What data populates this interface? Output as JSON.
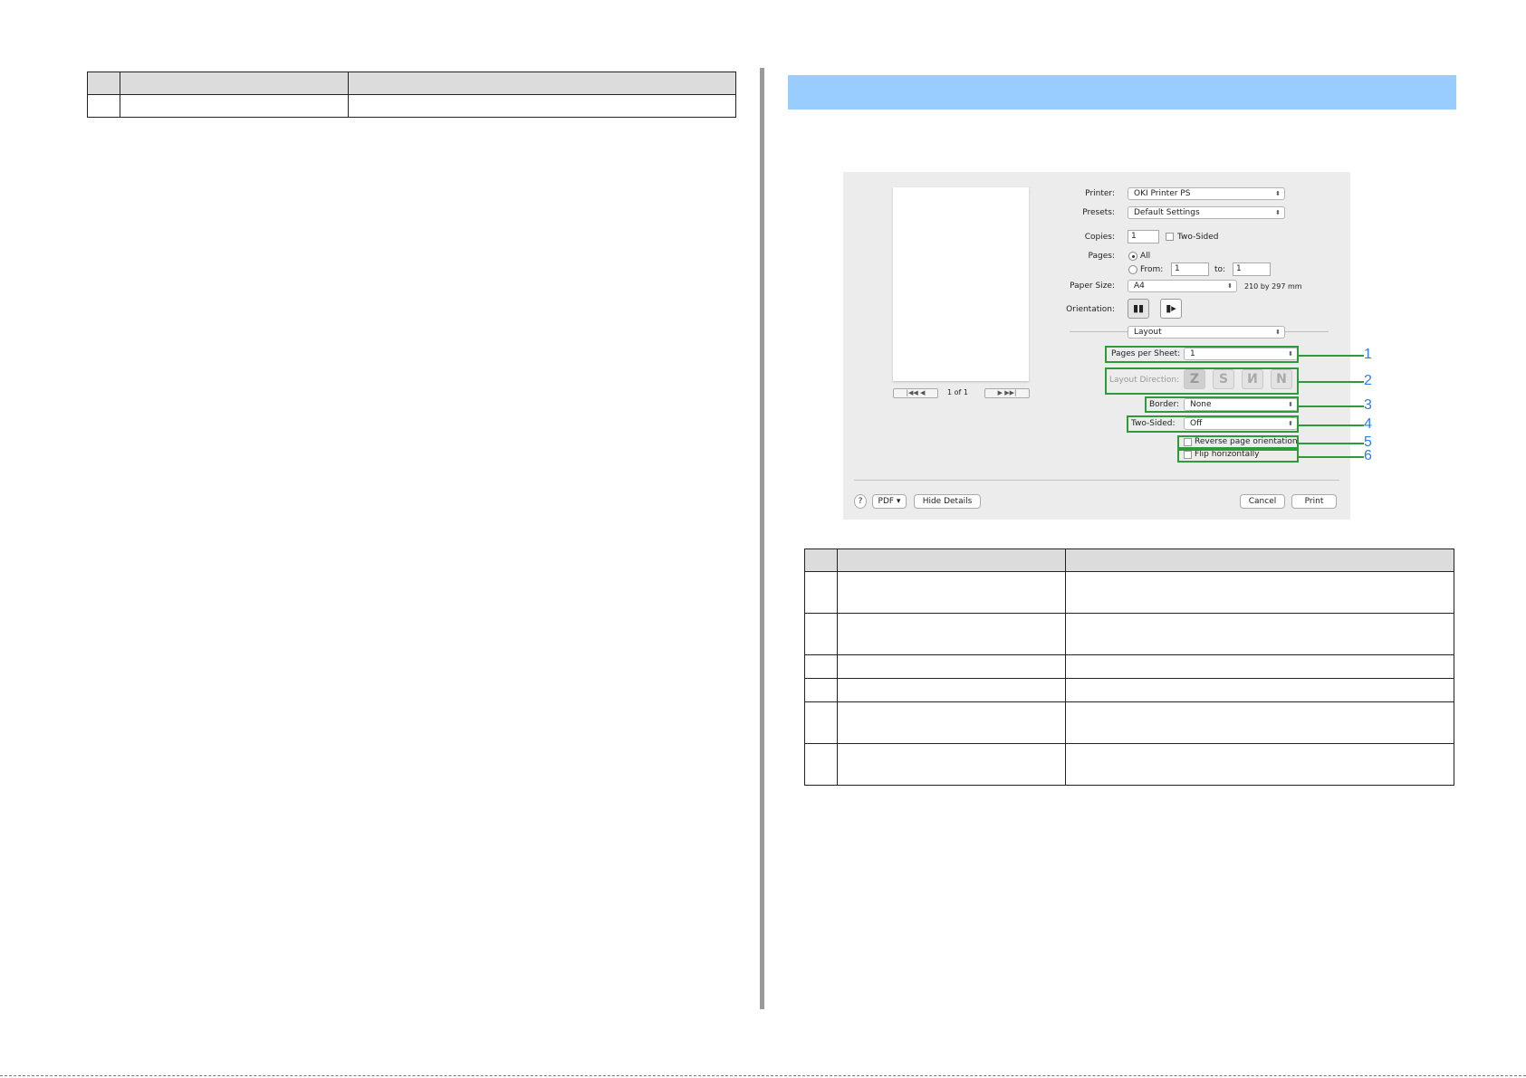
{
  "left_table": {
    "header": [
      "",
      "",
      ""
    ],
    "rows": [
      [
        "",
        "",
        ""
      ]
    ]
  },
  "right_table": {
    "header": [
      "",
      "",
      ""
    ],
    "rows": [
      [
        "",
        "",
        ""
      ],
      [
        "",
        "",
        ""
      ],
      [
        "",
        "",
        ""
      ],
      [
        "",
        "",
        ""
      ],
      [
        "",
        "",
        ""
      ],
      [
        "",
        "",
        ""
      ]
    ]
  },
  "dialog": {
    "printer_label": "Printer:",
    "printer_value": "OKI Printer PS",
    "presets_label": "Presets:",
    "presets_value": "Default Settings",
    "copies_label": "Copies:",
    "copies_value": "1",
    "two_sided_check_label": "Two-Sided",
    "pages_label": "Pages:",
    "pages_all": "All",
    "pages_from": "From:",
    "from_value": "1",
    "to_label": "to:",
    "to_value": "1",
    "paper_size_label": "Paper Size:",
    "paper_size_value": "A4",
    "paper_dims": "210 by 297 mm",
    "orientation_label": "Orientation:",
    "section_value": "Layout",
    "pages_per_sheet_label": "Pages per Sheet:",
    "pages_per_sheet_value": "1",
    "layout_direction_label": "Layout Direction:",
    "border_label": "Border:",
    "border_value": "None",
    "two_sided_label": "Two-Sided:",
    "two_sided_value": "Off",
    "reverse_label": "Reverse page orientation",
    "flip_label": "Flip horizontally",
    "page_indicator": "1 of 1",
    "help": "?",
    "pdf": "PDF ▾",
    "hide_details": "Hide Details",
    "cancel": "Cancel",
    "print": "Print",
    "arrows": "⬍",
    "nav_first_prev": "|◀◀  ◀",
    "nav_next_last": "▶  ▶▶|",
    "layout_dir_icons": [
      "Z",
      "S",
      "И",
      "N"
    ],
    "orient_portrait": "▮▮",
    "orient_landscape": "▮▸"
  },
  "callouts": [
    "1",
    "2",
    "3",
    "4",
    "5",
    "6"
  ]
}
